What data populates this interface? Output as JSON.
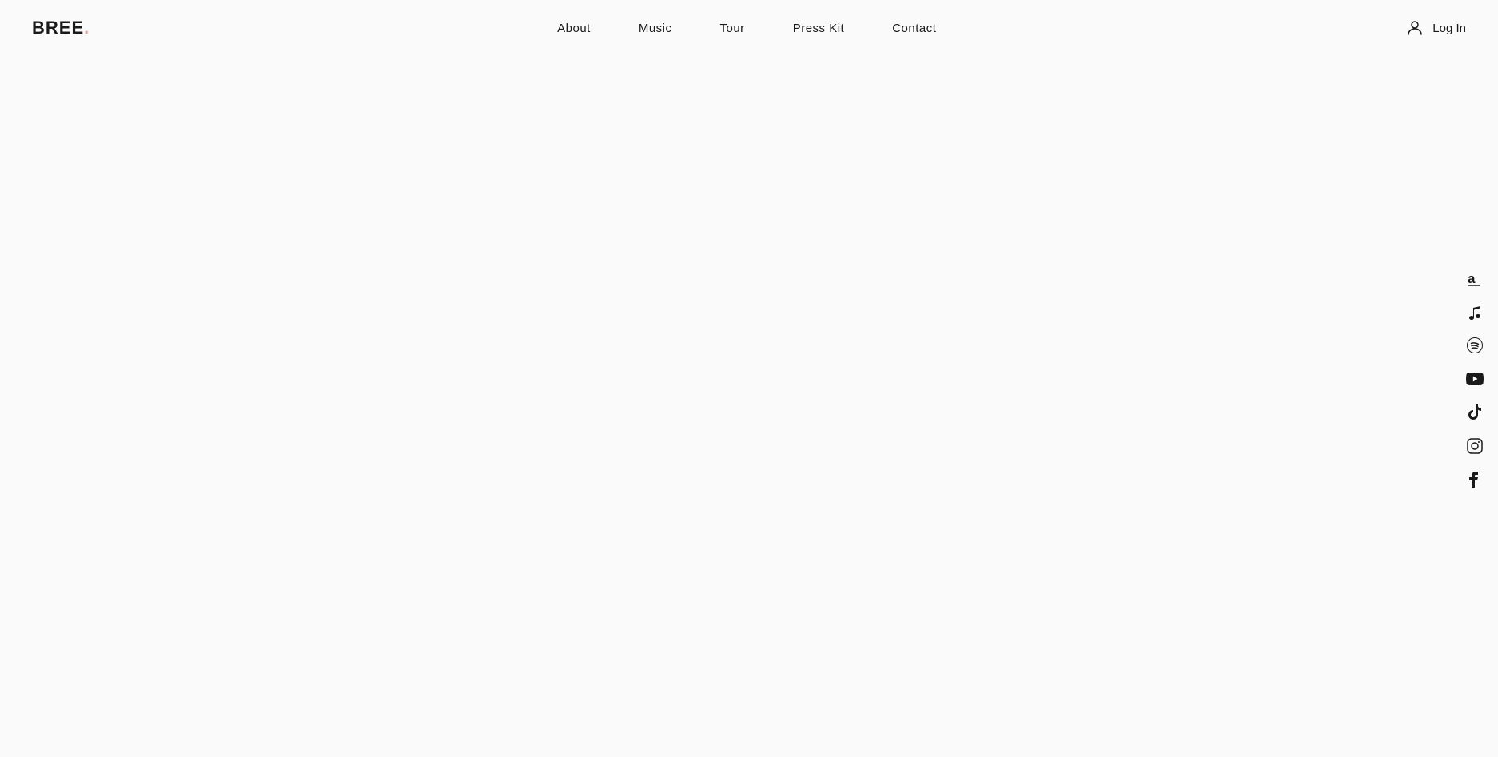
{
  "header": {
    "logo": {
      "text": "BREE",
      "dot": "."
    },
    "nav": {
      "items": [
        {
          "label": "About",
          "href": "#about"
        },
        {
          "label": "Music",
          "href": "#music"
        },
        {
          "label": "Tour",
          "href": "#tour"
        },
        {
          "label": "Press Kit",
          "href": "#press-kit"
        },
        {
          "label": "Contact",
          "href": "#contact"
        }
      ]
    },
    "auth": {
      "login_label": "Log In"
    }
  },
  "social": {
    "items": [
      {
        "name": "amazon-music",
        "icon": "amazon",
        "symbol": "a̲",
        "href": "#"
      },
      {
        "name": "apple-music",
        "icon": "music-note",
        "symbol": "♪",
        "href": "#"
      },
      {
        "name": "spotify",
        "icon": "spotify",
        "symbol": "Ⓢ",
        "href": "#"
      },
      {
        "name": "youtube",
        "icon": "youtube",
        "symbol": "▶",
        "href": "#"
      },
      {
        "name": "tiktok",
        "icon": "tiktok",
        "symbol": "🎵",
        "href": "#"
      },
      {
        "name": "instagram",
        "icon": "instagram",
        "symbol": "📷",
        "href": "#"
      },
      {
        "name": "facebook",
        "icon": "facebook",
        "symbol": "f",
        "href": "#"
      }
    ]
  },
  "main": {
    "background_color": "#fafafa"
  }
}
